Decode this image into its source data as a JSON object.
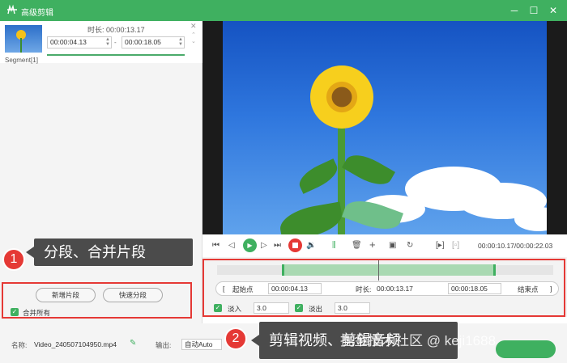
{
  "window": {
    "title": "高级剪辑",
    "controls": [
      "─",
      "☐",
      "✕"
    ]
  },
  "segment": {
    "label": "Segment[1]",
    "duration_label": "时长:",
    "duration_value": "00:00:13.17",
    "start_time": "00:00:04.13",
    "end_time": "00:00:18.05",
    "separator": "-",
    "close": "✕",
    "move": "◇"
  },
  "left_actions": {
    "new_segment": "新增片段",
    "quick_split": "快速分段",
    "merge_all": "合并所有"
  },
  "callout1": {
    "number": "1",
    "text": "分段、合并片段"
  },
  "callout2": {
    "number": "2",
    "text": "剪辑视频、剪辑音频"
  },
  "watermark": "掘金技术社区 @ keji1688",
  "player": {
    "timecode": "00:00:10.17/00:00:22.03"
  },
  "timeline": {
    "start_bracket": "[",
    "start_label": "起始点",
    "start_value": "00:00:04.13",
    "duration_label": "时长:",
    "duration_value": "00:00:13.17",
    "end_value": "00:00:18.05",
    "end_label": "结束点",
    "end_bracket": "]",
    "fade_in_label": "淡入",
    "fade_in_value": "3.0",
    "fade_out_label": "淡出",
    "fade_out_value": "3.0"
  },
  "bottom": {
    "name_label": "名称:",
    "filename": "Video_240507104950.mp4",
    "output_label": "输出:",
    "output_value": "自动Auto"
  },
  "colors": {
    "accent": "#3fb060",
    "highlight": "#e53935"
  }
}
